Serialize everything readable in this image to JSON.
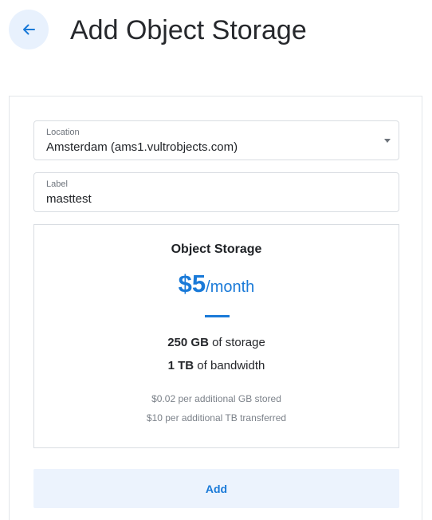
{
  "header": {
    "title": "Add Object Storage",
    "back_icon": "arrow-left-icon"
  },
  "form": {
    "location": {
      "caption": "Location",
      "value": "Amsterdam (ams1.vultrobjects.com)",
      "icon": "caret-down-icon"
    },
    "label": {
      "caption": "Label",
      "value": "masttest"
    }
  },
  "plan": {
    "title": "Object Storage",
    "price_amount": "$5",
    "price_period": "/month",
    "storage_amount": "250 GB",
    "storage_text": "of storage",
    "bandwidth_amount": "1 TB",
    "bandwidth_text": "of bandwidth",
    "note_storage": "$0.02 per additional GB stored",
    "note_transfer": "$10 per additional TB transferred"
  },
  "actions": {
    "add_label": "Add"
  },
  "colors": {
    "accent": "#1a7ad8",
    "accent_light": "#ecf3fd",
    "text": "#26282c",
    "muted": "#7c828a",
    "border": "#d9dde2"
  }
}
